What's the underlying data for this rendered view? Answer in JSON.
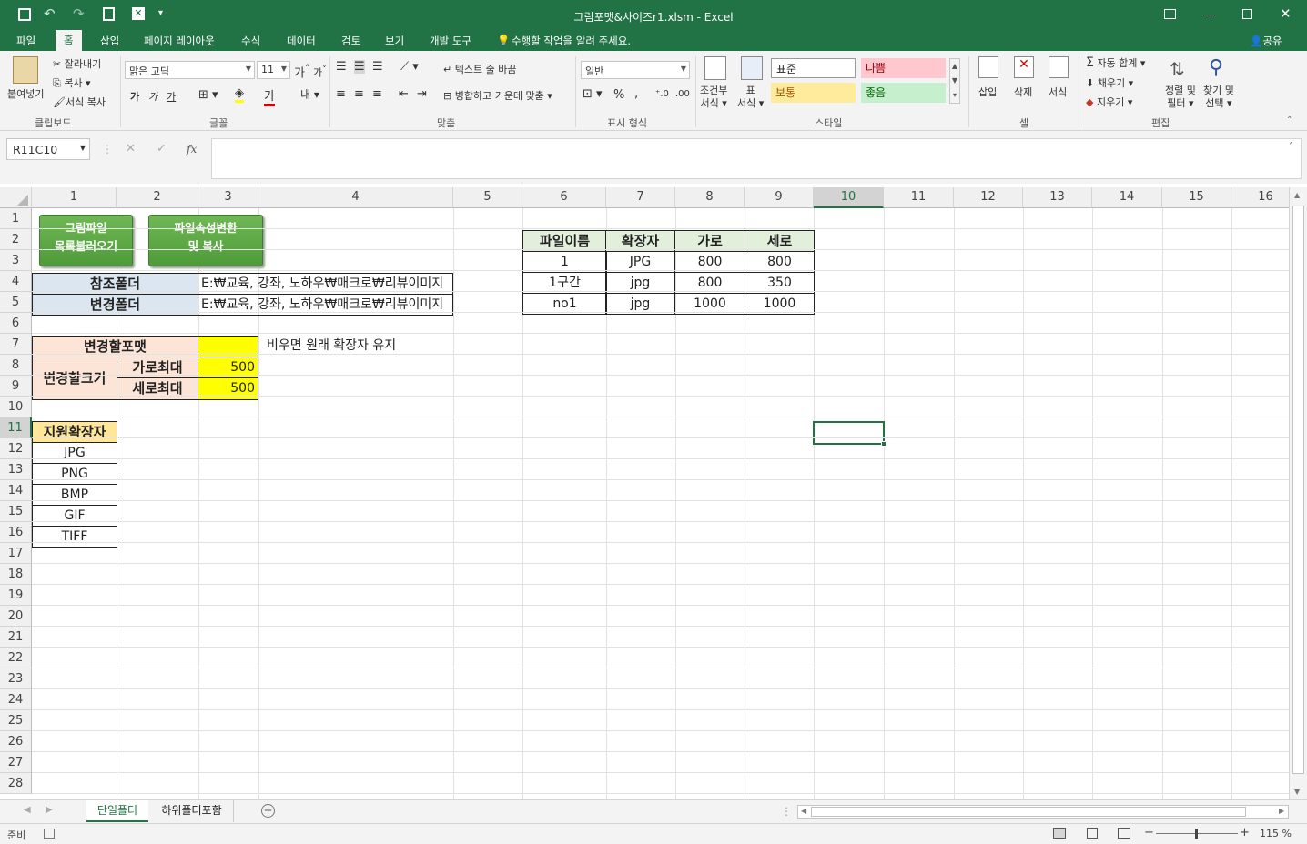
{
  "window": {
    "title": "그림포맷&사이즈r1.xlsm - Excel"
  },
  "tabs": [
    "파일",
    "홈",
    "삽입",
    "페이지 레이아웃",
    "수식",
    "데이터",
    "검토",
    "보기",
    "개발 도구"
  ],
  "tell_me": "수행할 작업을 알려 주세요.",
  "share": "공유",
  "ribbon": {
    "paste": "붙여넣기",
    "cut": "잘라내기",
    "copy": "복사",
    "format_painter": "서식 복사",
    "clipboard_group": "클립보드",
    "font_name": "맑은 고딕",
    "font_size": "11",
    "bold": "가",
    "italic": "가",
    "underline": "가",
    "font_group": "글꼴",
    "wrap_text": "텍스트 줄 바꿈",
    "merge_center": "병합하고 가운데 맞춤",
    "align_group": "맞춤",
    "number_format": "일반",
    "percent": "%",
    "number_group": "표시 형식",
    "cond_format_1": "조건부",
    "cond_format_2": "서식",
    "table_format_1": "표",
    "table_format_2": "서식",
    "style_normal": "표준",
    "style_bad": "나쁨",
    "style_neutral": "보통",
    "style_good": "좋음",
    "styles_group": "스타일",
    "insert": "삽입",
    "delete": "삭제",
    "format": "서식",
    "cells_group": "셀",
    "autosum": "자동 합계",
    "fill": "채우기",
    "clear": "지우기",
    "sort_filter_1": "정렬 및",
    "sort_filter_2": "필터",
    "find_select_1": "찾기 및",
    "find_select_2": "선택",
    "editing_group": "편집"
  },
  "namebox": "R11C10",
  "fx": "fx",
  "columns": [
    "1",
    "2",
    "3",
    "4",
    "5",
    "6",
    "7",
    "8",
    "9",
    "10",
    "11",
    "12",
    "13",
    "14",
    "15",
    "16"
  ],
  "rows": [
    "1",
    "2",
    "3",
    "4",
    "5",
    "6",
    "7",
    "8",
    "9",
    "10",
    "11",
    "12",
    "13",
    "14",
    "15",
    "16",
    "17",
    "18",
    "19",
    "20",
    "21",
    "22",
    "23",
    "24",
    "25",
    "26",
    "27",
    "28"
  ],
  "sheet": {
    "button1": [
      "그림파일",
      "목록불러오기"
    ],
    "button2": [
      "파일속성변환",
      "및 복사"
    ],
    "ref_folder_label": "참조폴더",
    "ref_folder_value": "E:₩교육, 강좌, 노하우₩매크로₩리뷰이미지",
    "chg_folder_label": "변경폴더",
    "chg_folder_value": "E:₩교육, 강좌, 노하우₩매크로₩리뷰이미지",
    "format_label": "변경할포맷",
    "format_value": "",
    "format_note": "비우면 원래 확장자 유지",
    "size_label": "변경할크기",
    "width_max_label": "가로최대",
    "width_max_value": "500",
    "height_max_label": "세로최대",
    "height_max_value": "500",
    "ext_header": "지원확장자",
    "extensions": [
      "JPG",
      "PNG",
      "BMP",
      "GIF",
      "TIFF"
    ],
    "file_table": {
      "headers": [
        "파일이름",
        "확장자",
        "가로",
        "세로"
      ],
      "rows": [
        [
          "1",
          "JPG",
          "800",
          "800"
        ],
        [
          "1구간",
          "jpg",
          "800",
          "350"
        ],
        [
          "no1",
          "jpg",
          "1000",
          "1000"
        ]
      ]
    }
  },
  "sheet_tabs": [
    "단일폴더",
    "하위폴더포함"
  ],
  "status": {
    "ready": "준비",
    "zoom": "115 %"
  }
}
